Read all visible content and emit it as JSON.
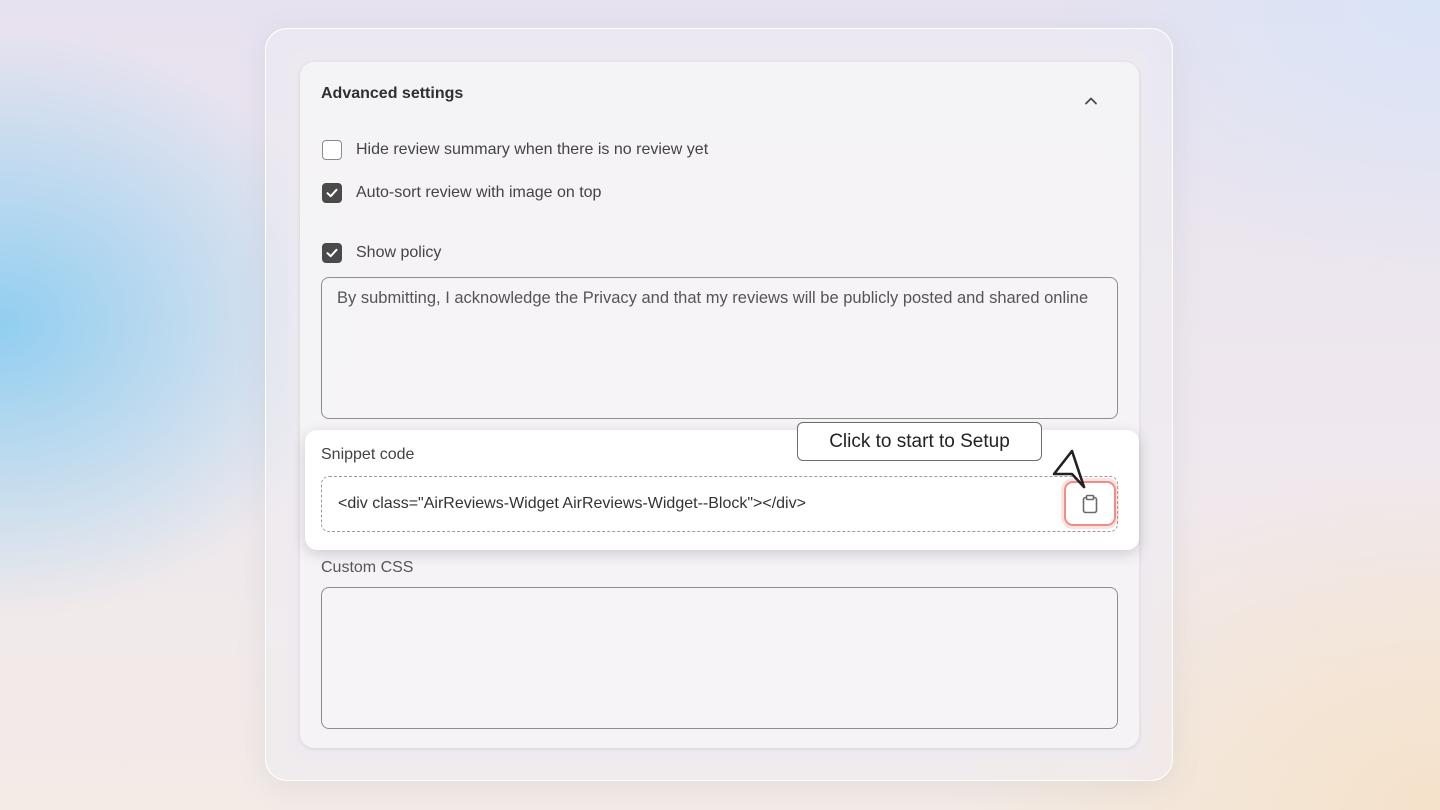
{
  "settings": {
    "title": "Advanced settings",
    "collapse_icon": "chevron-up-icon",
    "options": [
      {
        "label": "Hide review summary when there is no review yet",
        "checked": false
      },
      {
        "label": "Auto-sort review with image on top",
        "checked": true
      },
      {
        "label": "Show policy",
        "checked": true
      }
    ],
    "policy_text": "By submitting, I acknowledge the Privacy and that my reviews will be publicly posted and shared online",
    "snippet": {
      "label": "Snippet code",
      "code": "<div class=\"AirReviews-Widget AirReviews-Widget--Block\"></div>",
      "copy_icon": "clipboard-icon"
    },
    "custom_css": {
      "label": "Custom CSS",
      "value": ""
    }
  },
  "tooltip": {
    "text": "Click to start to Setup"
  },
  "colors": {
    "copy_highlight": "#ee8e84",
    "checkbox_checked": "#4a4a4a"
  }
}
